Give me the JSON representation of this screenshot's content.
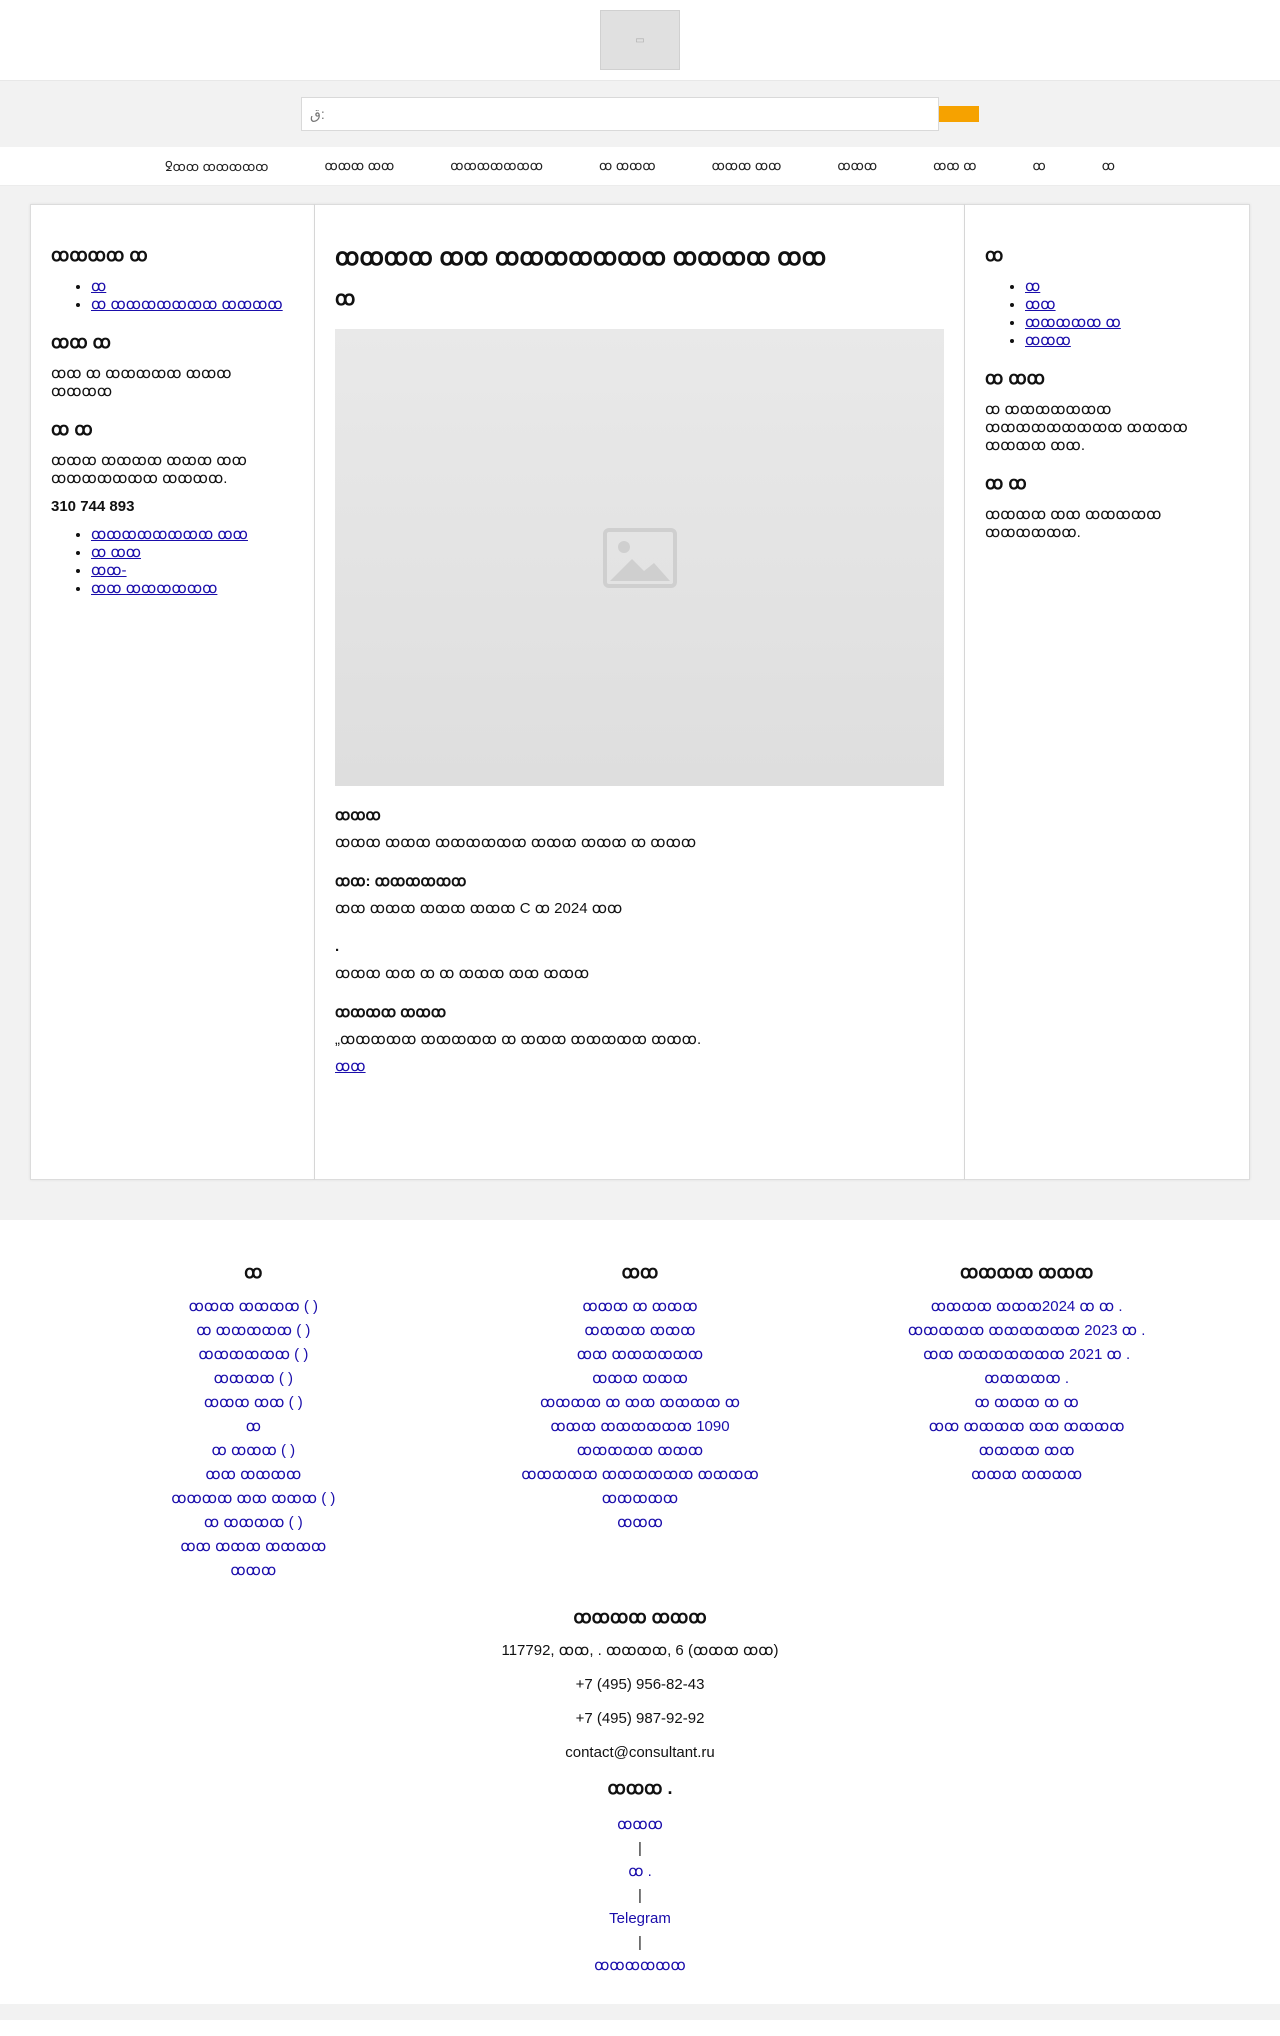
{
  "header": {
    "logo_label": "▭"
  },
  "search": {
    "placeholder": "ق:"
  },
  "nav": {
    "items": [
      "ꝿꝏꝏ ꝏꝏꝏꝏꝏ",
      "ꝏꝏꝏ ꝏꝏ",
      "ꝏꝏꝏꝏꝏꝏꝏ",
      "ꝏ ꝏꝏꝏ",
      "ꝏꝏꝏ ꝏꝏ",
      "ꝏꝏꝏ",
      "ꝏꝏ ꝏ",
      "ꝏ",
      "ꝏ"
    ]
  },
  "left": {
    "h1": "ꝏꝏꝏꝏ ꝏ",
    "links1": [
      "ꝏ",
      "ꝏ ꝏꝏꝏꝏꝏꝏꝏ ꝏꝏꝏꝏ"
    ],
    "h2": "ꝏꝏ ꝏ",
    "p1": "ꝏꝏ ꝏ ꝏꝏꝏꝏꝏ ꝏꝏꝏ ꝏꝏꝏꝏ",
    "h3": "ꝏ ꝏ",
    "p2": "ꝏꝏꝏ ꝏꝏꝏꝏ ꝏꝏꝏ ꝏꝏ ꝏꝏꝏꝏꝏꝏꝏ ꝏꝏꝏꝏ.",
    "phone": "310 744 893",
    "links2": [
      "ꝏꝏꝏꝏꝏꝏꝏꝏ ꝏꝏ",
      "ꝏ ꝏꝏ",
      "ꝏꝏ-",
      "ꝏꝏ ꝏꝏꝏꝏꝏꝏ"
    ]
  },
  "center": {
    "title": "ꝏꝏꝏꝏ ꝏꝏ ꝏꝏꝏꝏꝏꝏꝏ ꝏꝏꝏꝏ ꝏꝏ",
    "subtitle": "ꝏ",
    "h_a": "ꝏꝏꝏ",
    "p_a": "ꝏꝏꝏ ꝏꝏꝏ ꝏꝏꝏꝏꝏꝏ ꝏꝏꝏ ꝏꝏꝏ ꝏ ꝏꝏꝏ",
    "h_b": "ꝏꝏ: ꝏꝏꝏꝏꝏꝏ",
    "p_b": "ꝏꝏ ꝏꝏꝏ ꝏꝏꝏ ꝏꝏꝏ C ꝏ 2024 ꝏꝏ",
    "h_c": ".",
    "p_c": "ꝏꝏꝏ ꝏꝏ ꝏ ꝏ ꝏꝏꝏ ꝏꝏ ꝏꝏꝏ",
    "h_d": "ꝏꝏꝏꝏ ꝏꝏꝏ",
    "p_d": "„ꝏꝏꝏꝏꝏ ꝏꝏꝏꝏꝏ ꝏ ꝏꝏꝏ ꝏꝏꝏꝏꝏ ꝏꝏꝏ.",
    "link": "ꝏꝏ"
  },
  "right": {
    "h1": "ꝏ",
    "links": [
      "ꝏ",
      "ꝏꝏ",
      "ꝏꝏꝏꝏꝏ ꝏ",
      "ꝏꝏꝏ"
    ],
    "h2": "ꝏ ꝏꝏ",
    "p1": "ꝏ ꝏꝏꝏꝏꝏꝏꝏ ꝏꝏꝏꝏꝏꝏꝏꝏꝏ ꝏꝏꝏꝏ ꝏꝏꝏꝏ ꝏꝏ.",
    "h3": "ꝏ ꝏ",
    "p2": "ꝏꝏꝏꝏ ꝏꝏ ꝏꝏꝏꝏꝏ ꝏꝏꝏꝏꝏꝏ."
  },
  "footer": {
    "col1": {
      "title": "ꝏ",
      "links": [
        "ꝏꝏꝏ ꝏꝏꝏꝏ ( )",
        "ꝏ ꝏꝏꝏꝏꝏ ( )",
        "ꝏꝏꝏꝏꝏꝏ ( )",
        "ꝏꝏꝏꝏ ( )",
        "ꝏꝏꝏ ꝏꝏ ( )",
        "ꝏ",
        "ꝏ ꝏꝏꝏ ( )",
        "ꝏꝏ ꝏꝏꝏꝏ",
        "ꝏꝏꝏꝏ ꝏꝏ ꝏꝏꝏ ( )",
        "ꝏ ꝏꝏꝏꝏ ( )",
        "ꝏꝏ ꝏꝏꝏ ꝏꝏꝏꝏ",
        "ꝏꝏꝏ"
      ]
    },
    "col2": {
      "title": "ꝏꝏ",
      "links": [
        "ꝏꝏꝏ ꝏ ꝏꝏꝏ",
        "ꝏꝏꝏꝏ ꝏꝏꝏ",
        "ꝏꝏ ꝏꝏꝏꝏꝏꝏ",
        "ꝏꝏꝏ ꝏꝏꝏ",
        "ꝏꝏꝏꝏ ꝏ ꝏꝏ ꝏꝏꝏꝏ ꝏ",
        "ꝏꝏꝏ ꝏꝏꝏꝏꝏꝏ 1090",
        "ꝏꝏꝏꝏꝏ ꝏꝏꝏ",
        "ꝏꝏꝏꝏꝏ ꝏꝏꝏꝏꝏꝏ ꝏꝏꝏꝏ ꝏꝏꝏꝏꝏ",
        "ꝏꝏꝏ"
      ]
    },
    "col3": {
      "title": "ꝏꝏꝏꝏ ꝏꝏꝏ",
      "links": [
        "ꝏꝏꝏꝏ ꝏꝏꝏ2024 ꝏ ꝏ .",
        "ꝏꝏꝏꝏꝏ ꝏꝏꝏꝏꝏꝏ 2023 ꝏ .",
        "ꝏꝏ ꝏꝏꝏꝏꝏꝏꝏ 2021 ꝏ .",
        "ꝏꝏꝏꝏꝏ .",
        "ꝏ ꝏꝏꝏ ꝏ ꝏ",
        "ꝏꝏ ꝏꝏꝏꝏ ꝏꝏ ꝏꝏꝏꝏ",
        "ꝏꝏꝏꝏ ꝏꝏ",
        "ꝏꝏꝏ ꝏꝏꝏꝏ"
      ]
    }
  },
  "contacts": {
    "title": "ꝏꝏꝏꝏ ꝏꝏꝏ",
    "address": "117792, ꝏꝏ, . ꝏꝏꝏꝏ, 6 (ꝏꝏꝏ ꝏꝏ)",
    "phone1": "+7 (495) 956-82-43",
    "phone2": "+7 (495) 987-92-92",
    "email": "contact@consultant.ru"
  },
  "social": {
    "title": "ꝏꝏꝏ .",
    "link1": "ꝏꝏꝏ",
    "sep": "|",
    "link2": "ꝏ .",
    "link3": "Telegram",
    "link4": "ꝏꝏꝏꝏꝏꝏ"
  },
  "colors": {
    "accent": "#f6a200",
    "link": "#1a0dab",
    "bg": "#f2f2f2"
  }
}
